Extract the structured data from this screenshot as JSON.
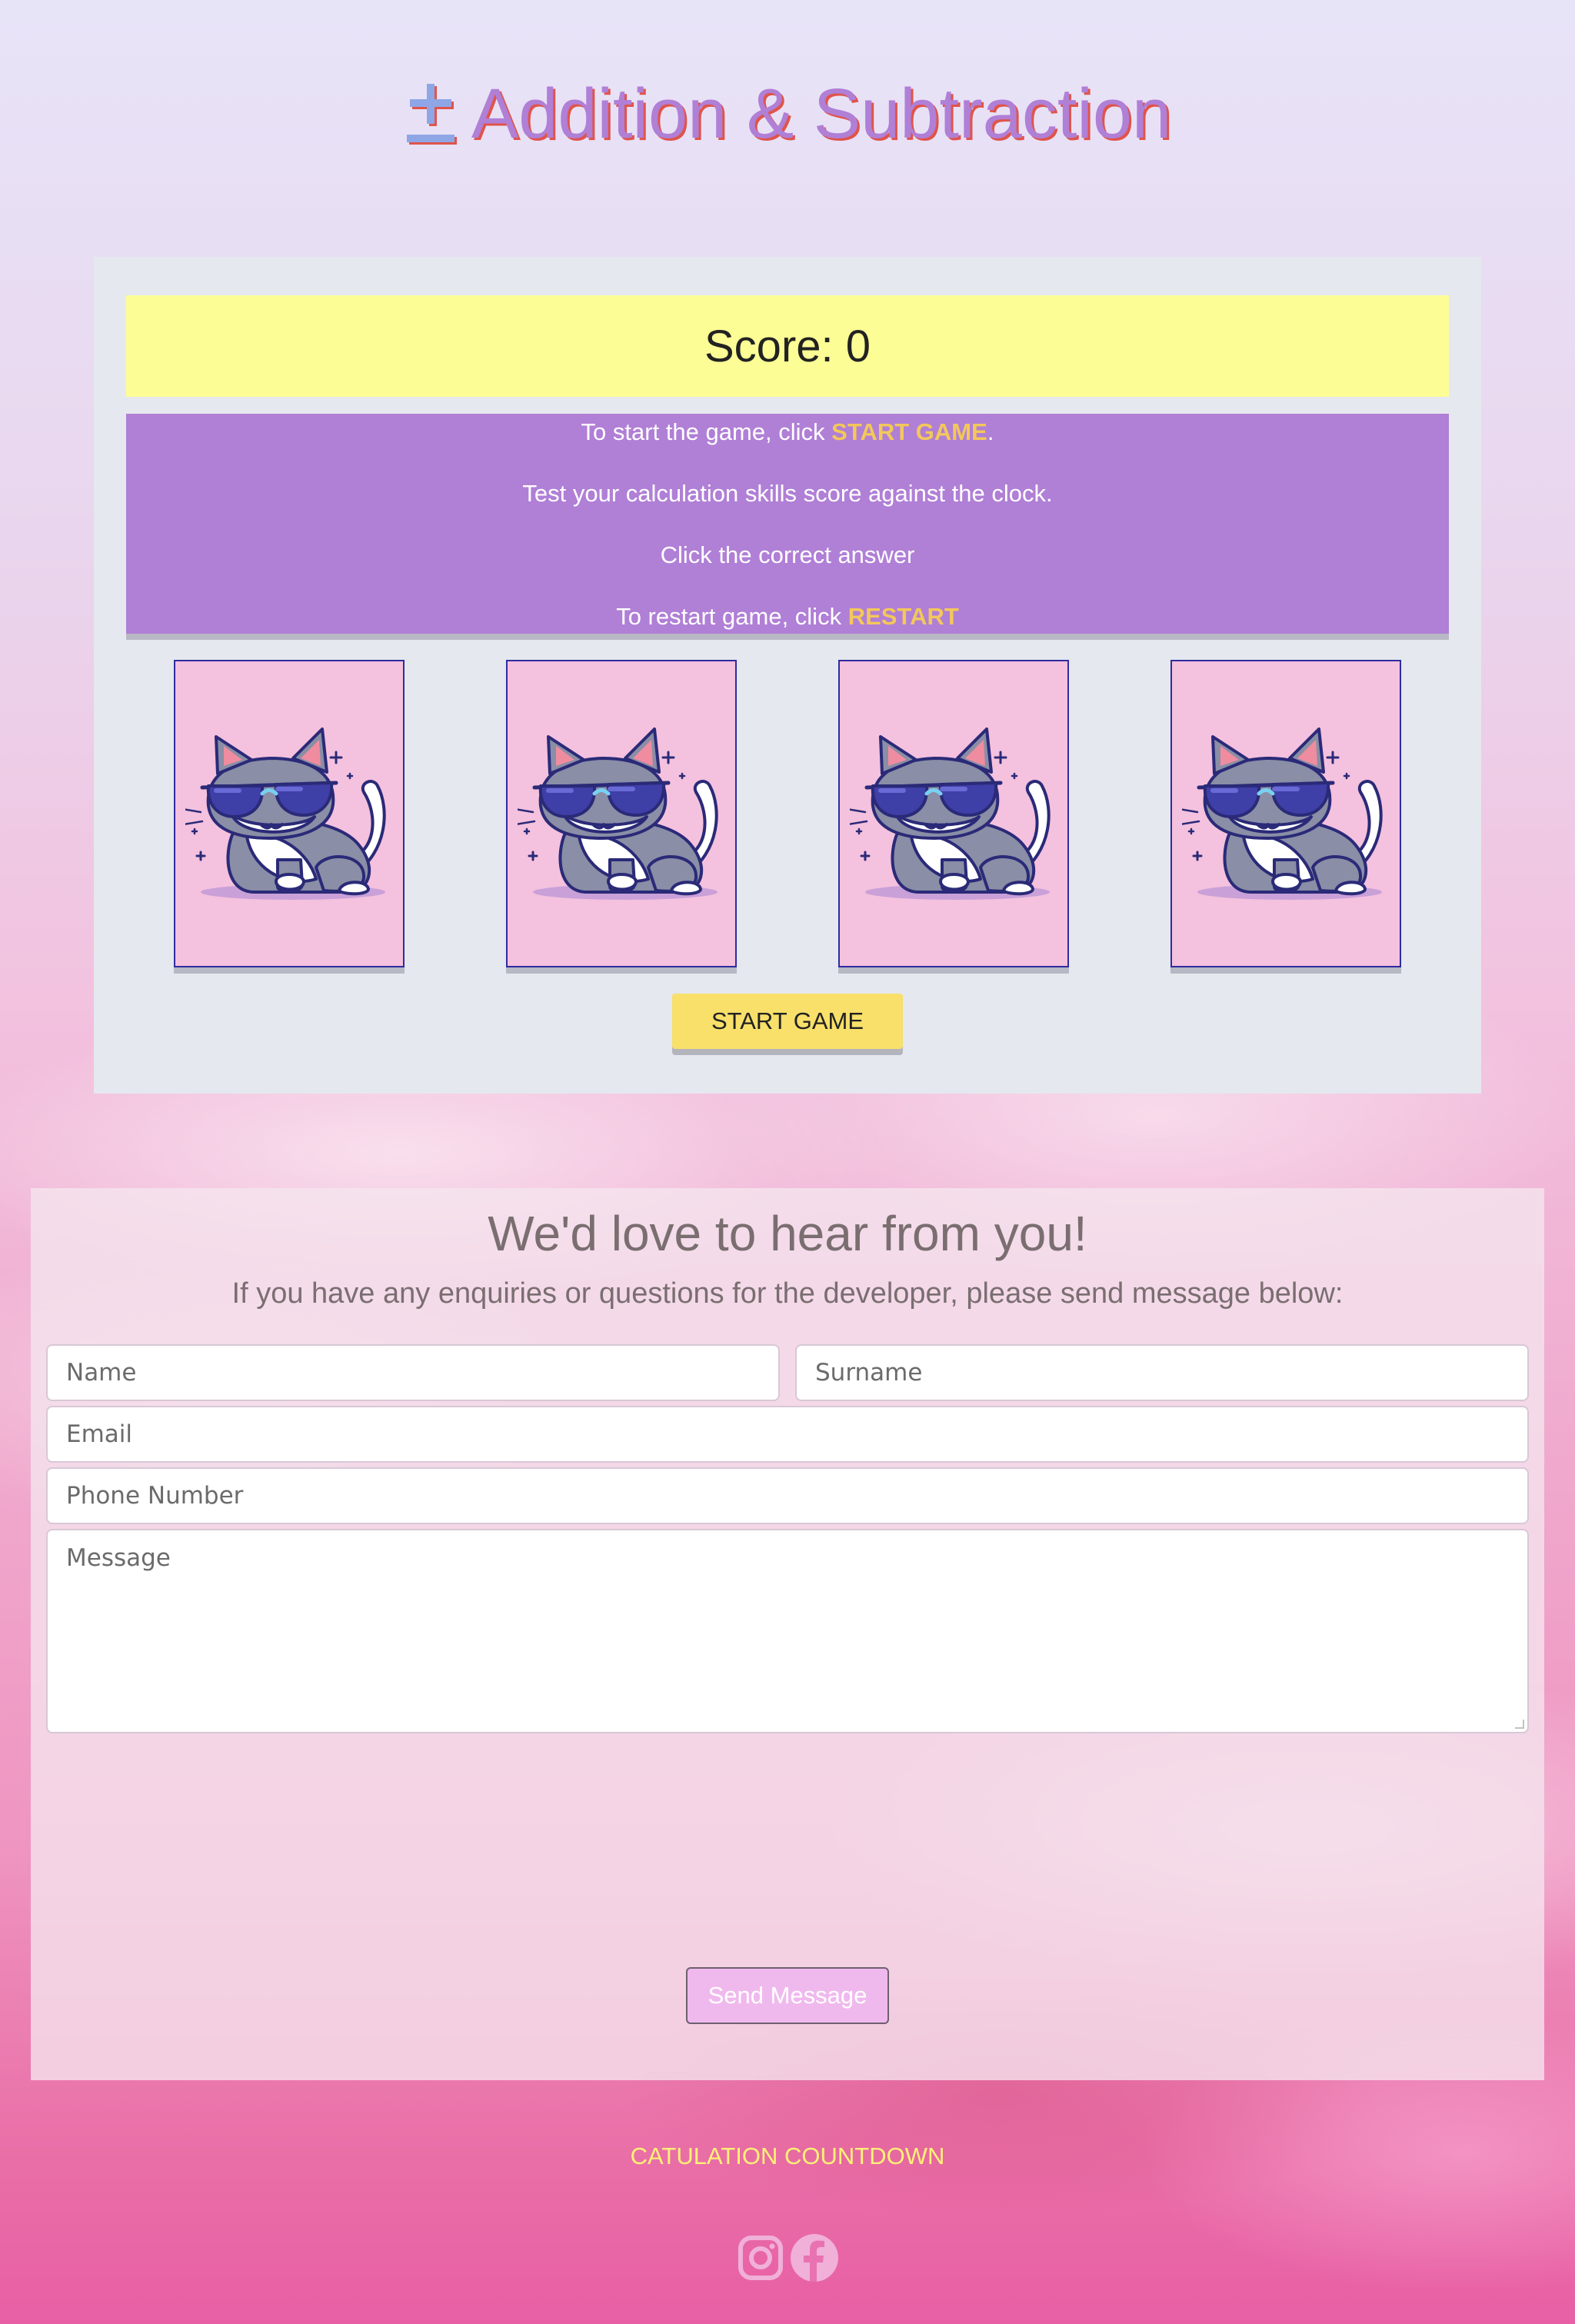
{
  "header": {
    "icon": "plus-minus-icon",
    "title": "Addition & Subtraction"
  },
  "game": {
    "score_label": "Score: 0",
    "instructions": {
      "line1_prefix": "To start the game, click ",
      "line1_highlight": "START GAME",
      "line1_suffix": ".",
      "line2": "Test your calculation skills score against the clock.",
      "line3": "Click the correct answer",
      "line4_prefix": "To restart game, click ",
      "line4_highlight": "RESTART"
    },
    "cards": [
      {
        "image": "cool-cat-sunglasses"
      },
      {
        "image": "cool-cat-sunglasses"
      },
      {
        "image": "cool-cat-sunglasses"
      },
      {
        "image": "cool-cat-sunglasses"
      }
    ],
    "start_button": "START GAME"
  },
  "contact": {
    "heading": "We'd love to hear from you!",
    "subheading": "If you have any enquiries or questions for the developer, please send message below:",
    "fields": {
      "name_placeholder": "Name",
      "surname_placeholder": "Surname",
      "email_placeholder": "Email",
      "phone_placeholder": "Phone Number",
      "message_placeholder": "Message"
    },
    "send_button": "Send Message"
  },
  "footer": {
    "title": "CATULATION COUNTDOWN",
    "socials": [
      "instagram-icon",
      "facebook-icon"
    ]
  },
  "colors": {
    "title": "#b07fd6",
    "title_shadow": "#e0544a",
    "score_bg": "#fdfd96",
    "instructions_bg": "#b07fd6",
    "highlight": "#f3c85a",
    "card_bg": "#f4c1de",
    "start_button": "#f8e06a",
    "send_button": "#f0b9ee",
    "footer_text": "#fff176"
  }
}
